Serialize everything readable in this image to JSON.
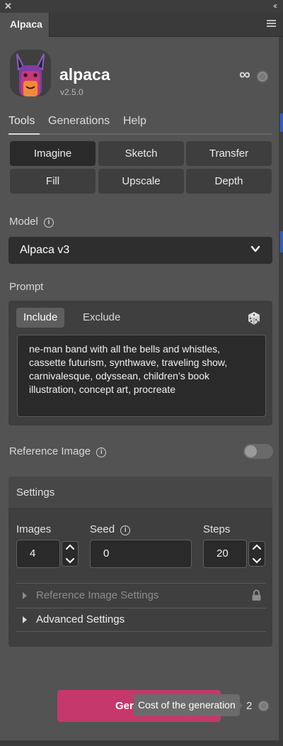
{
  "window": {
    "close_glyph": "✕",
    "collapse_glyph": "‹‹"
  },
  "panel_tab": {
    "label": "Alpaca"
  },
  "header": {
    "app_name": "alpaca",
    "version": "v2.5.0",
    "infinity": "∞"
  },
  "nav": {
    "items": [
      {
        "label": "Tools",
        "active": true
      },
      {
        "label": "Generations"
      },
      {
        "label": "Help"
      }
    ]
  },
  "tools": [
    {
      "label": "Imagine",
      "active": true
    },
    {
      "label": "Sketch"
    },
    {
      "label": "Transfer"
    },
    {
      "label": "Fill"
    },
    {
      "label": "Upscale"
    },
    {
      "label": "Depth"
    }
  ],
  "model": {
    "label": "Model",
    "info": "i",
    "selected": "Alpaca v3"
  },
  "prompt": {
    "label": "Prompt",
    "tabs": [
      {
        "label": "Include",
        "active": true
      },
      {
        "label": "Exclude"
      }
    ],
    "text": "ne-man band with all the bells and whistles, cassette futurism, synthwave, traveling show, carnivalesque, odyssean, children’s book illustration, concept art, procreate"
  },
  "reference_image": {
    "label": "Reference Image",
    "info": "i",
    "enabled": false
  },
  "settings": {
    "title": "Settings",
    "images": {
      "label": "Images",
      "value": "4"
    },
    "seed": {
      "label": "Seed",
      "info": "i",
      "value": "0"
    },
    "steps": {
      "label": "Steps",
      "value": "20"
    },
    "reference_image_settings": {
      "label": "Reference Image Settings",
      "locked": true
    },
    "advanced_settings": {
      "label": "Advanced Settings"
    }
  },
  "generate": {
    "label_visible": "Ger",
    "tooltip": "Cost of the generation",
    "cost": "2"
  },
  "colors": {
    "accent": "#c5386b",
    "panel": "#535353",
    "dark": "#2a2a2a"
  },
  "icons": [
    "close-icon",
    "collapse-icon",
    "menu-icon",
    "alpaca-logo",
    "infinity-icon",
    "credit-coin-icon",
    "info-icon",
    "chevron-down-icon",
    "dice-icon",
    "lock-icon",
    "caret-right-icon"
  ]
}
